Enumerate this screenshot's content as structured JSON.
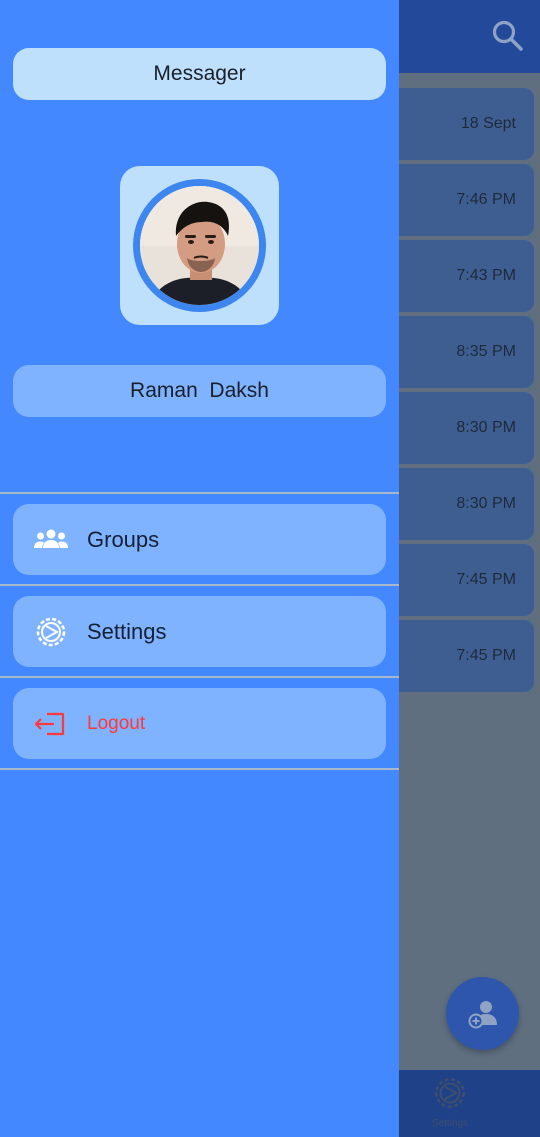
{
  "app": {
    "search_icon": "search-icon",
    "chat_times": [
      "18 Sept",
      "7:46 PM",
      "7:43 PM",
      "8:35 PM",
      "8:30 PM",
      "8:30 PM",
      "7:45 PM",
      "7:45 PM"
    ],
    "fab_icon": "add-person-icon",
    "bottom_nav": {
      "label": "Settings",
      "icon": "settings-icon"
    }
  },
  "drawer": {
    "title": "Messager",
    "user_name": "Raman  Daksh",
    "menu": [
      {
        "label": "Groups",
        "icon": "groups-icon"
      },
      {
        "label": "Settings",
        "icon": "settings-icon"
      },
      {
        "label": "Logout",
        "icon": "logout-icon"
      }
    ]
  },
  "colors": {
    "drawer_bg": "#4488ff",
    "pill_light": "#bfe0fc",
    "pill_mid": "#7fb3ff",
    "header": "#23499a",
    "logout": "#ff3838"
  }
}
